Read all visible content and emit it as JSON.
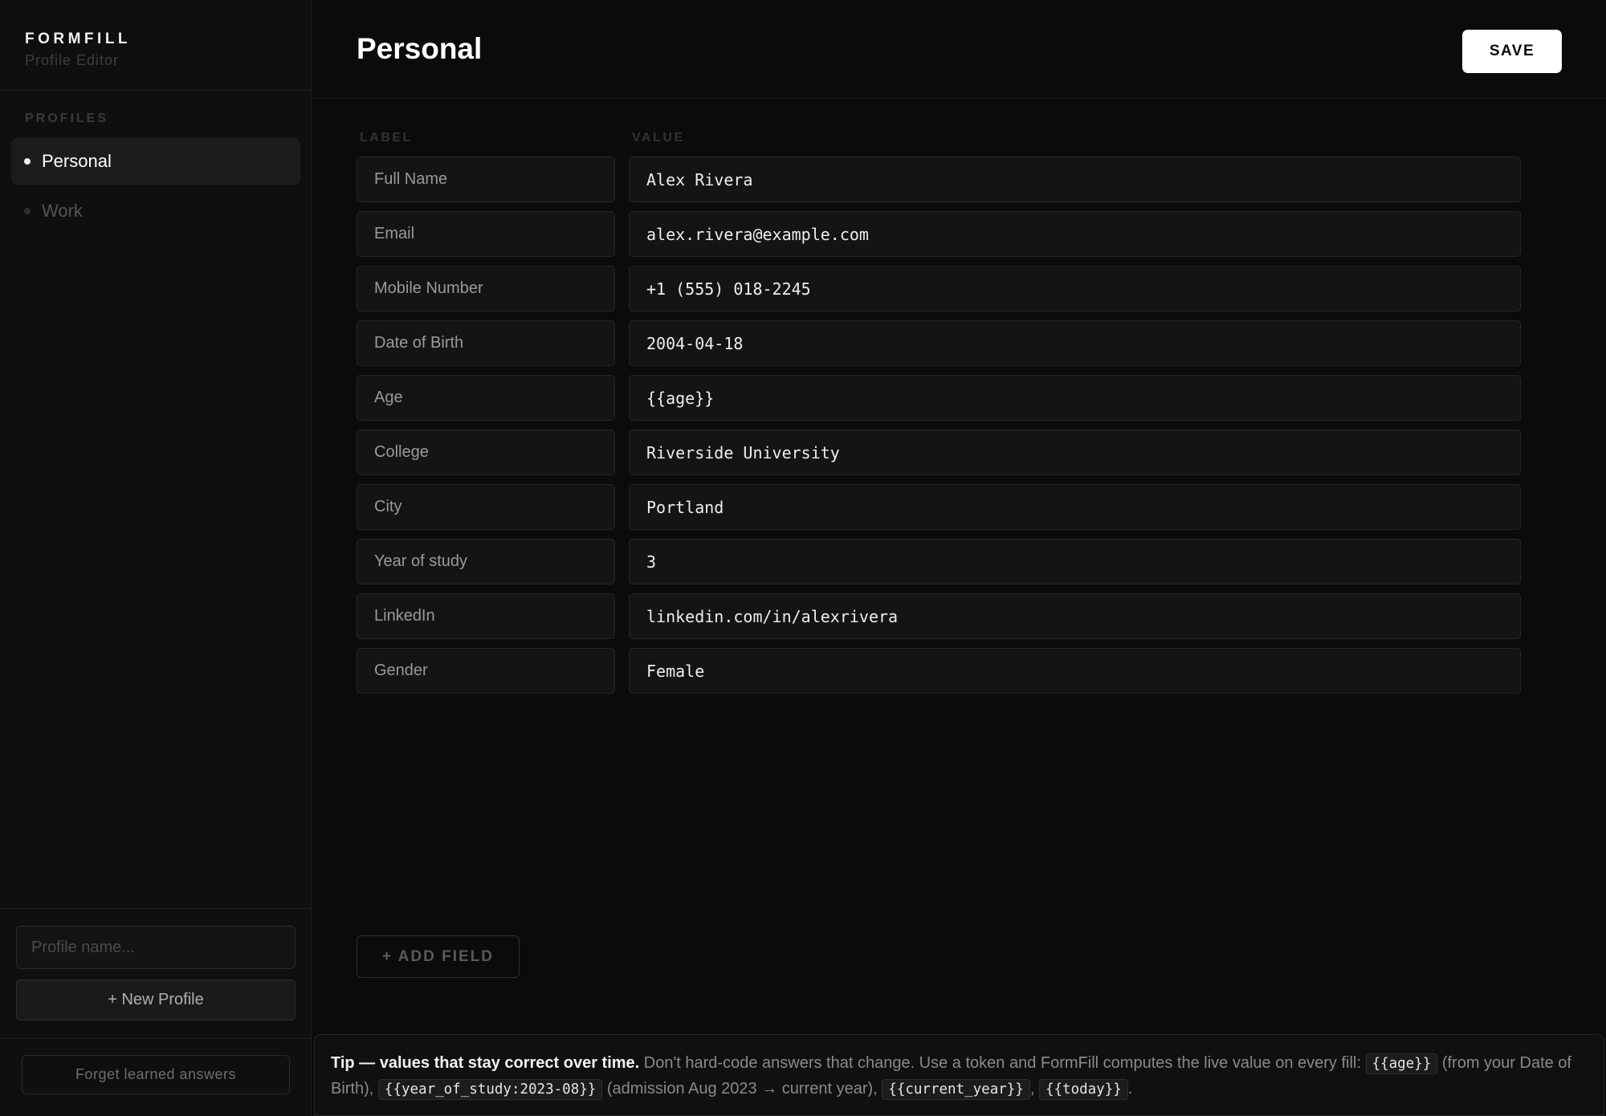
{
  "app": {
    "brand": "FORMFILL",
    "subtitle": "Profile Editor"
  },
  "sidebar": {
    "section_label": "PROFILES",
    "profiles": [
      {
        "label": "Personal",
        "active": true
      },
      {
        "label": "Work",
        "active": false
      }
    ],
    "profile_name_placeholder": "Profile name...",
    "new_profile_label": "+ New Profile",
    "forget_label": "Forget learned answers"
  },
  "header": {
    "title": "Personal",
    "save_label": "SAVE"
  },
  "columns": {
    "label": "LABEL",
    "value": "VALUE"
  },
  "fields": [
    {
      "label": "Full Name",
      "value": "Alex Rivera"
    },
    {
      "label": "Email",
      "value": "alex.rivera@example.com"
    },
    {
      "label": "Mobile Number",
      "value": "+1 (555) 018-2245"
    },
    {
      "label": "Date of Birth",
      "value": "2004-04-18"
    },
    {
      "label": "Age",
      "value": "{{age}}"
    },
    {
      "label": "College",
      "value": "Riverside University"
    },
    {
      "label": "City",
      "value": "Portland"
    },
    {
      "label": "Year of study",
      "value": "3"
    },
    {
      "label": "LinkedIn",
      "value": "linkedin.com/in/alexrivera"
    },
    {
      "label": "Gender",
      "value": "Female"
    }
  ],
  "add_field_label": "+ ADD FIELD",
  "tip": {
    "title": "Tip — values that stay correct over time.",
    "text1": " Don't hard-code answers that change. Use a token and FormFill computes the live value on every fill: ",
    "token_age": "{{age}}",
    "text2": " (from your Date of Birth), ",
    "token_year_of_study": "{{year_of_study:2023-08}}",
    "text3": " (admission Aug 2023 → current year), ",
    "token_current_year": "{{current_year}}",
    "sep": ", ",
    "token_today": "{{today}}",
    "end": "."
  }
}
